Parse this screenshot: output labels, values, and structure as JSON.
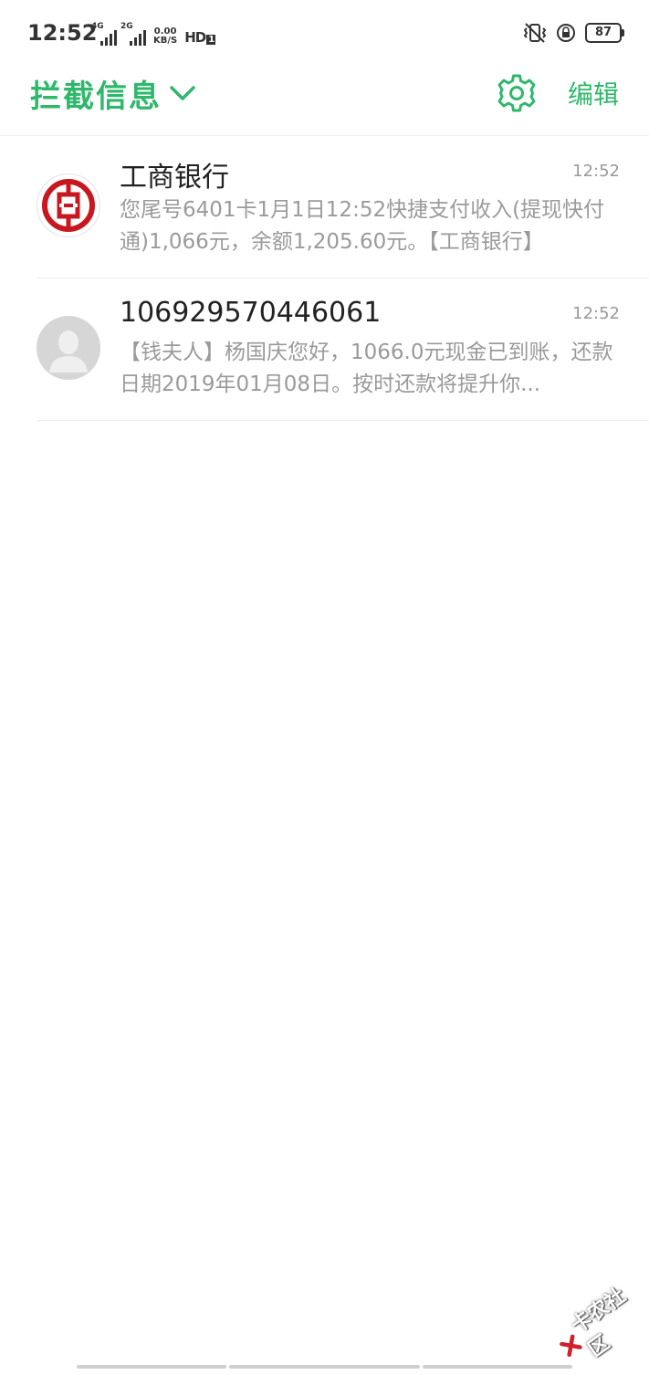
{
  "status_bar": {
    "time": "12:52",
    "network_1": "4G",
    "network_2": "2G",
    "speed_value": "0.00",
    "speed_unit": "KB/S",
    "hd_label": "HD",
    "hd_slot": "1",
    "battery_level": "87"
  },
  "header": {
    "title": "拦截信息",
    "edit_label": "编辑"
  },
  "messages": [
    {
      "sender": "工商银行",
      "time": "12:52",
      "preview": "您尾号6401卡1月1日12:52快捷支付收入(提现快付通)1,066元，余额1,205.60元。【工商银行】",
      "avatar": "icbc-logo",
      "avatar_color": "#c8171e"
    },
    {
      "sender": "106929570446061",
      "time": "12:52",
      "preview": "【钱夫人】杨国庆您好，1066.0元现金已到账，还款日期2019年01月08日。按时还款将提升你...",
      "avatar": "default-contact-avatar"
    }
  ],
  "watermark": {
    "text": "卡农社区"
  },
  "colors": {
    "accent": "#2fb86b",
    "text_primary": "#222222",
    "text_secondary": "#9a9a9a"
  }
}
